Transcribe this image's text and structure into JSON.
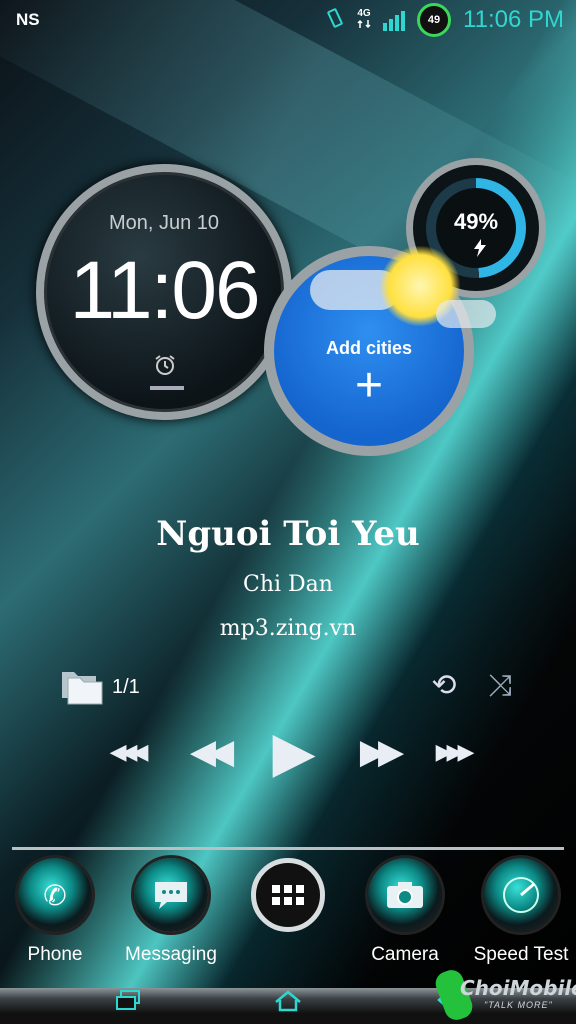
{
  "status_bar": {
    "carrier": "NS",
    "network": "4G",
    "battery_level": "49",
    "time": "11:06 PM",
    "icons": [
      "vibrate-icon",
      "data-4g-icon",
      "signal-bars-icon",
      "battery-ring-icon"
    ]
  },
  "clock_widget": {
    "date": "Mon, Jun 10",
    "time": "11:06",
    "alarm_icon": "alarm-clock-icon"
  },
  "battery_widget": {
    "percent_text": "49%",
    "level": 0.49,
    "icon": "lightning-bolt-icon",
    "ring_color": "#2fb5e6"
  },
  "weather_widget": {
    "label": "Add cities",
    "plus": "+",
    "background_color": "#1e78e0"
  },
  "music_player": {
    "title": "Nguoi Toi Yeu",
    "artist": "Chi Dan",
    "source": "mp3.zing.vn",
    "track_count": "1/1",
    "icons": [
      "folder-icon",
      "repeat-one-icon",
      "shuffle-icon",
      "skip-previous-icon",
      "rewind-icon",
      "play-icon",
      "fast-forward-icon",
      "skip-next-icon"
    ]
  },
  "dock": {
    "items": [
      {
        "label": "Phone",
        "icon": "phone-icon"
      },
      {
        "label": "Messaging",
        "icon": "message-icon"
      },
      {
        "label": "",
        "icon": "app-drawer-icon"
      },
      {
        "label": "Camera",
        "icon": "camera-icon"
      },
      {
        "label": "Speed Test",
        "icon": "speedometer-icon"
      }
    ]
  },
  "nav_bar": {
    "icons": [
      "recent-apps-icon",
      "home-icon",
      "back-icon"
    ]
  },
  "watermark": {
    "brand": "ChoiMobile",
    "tagline": "\"TALK MORE\""
  },
  "colors": {
    "accent": "#2fd7d0",
    "battery_green": "#3cd75a"
  }
}
